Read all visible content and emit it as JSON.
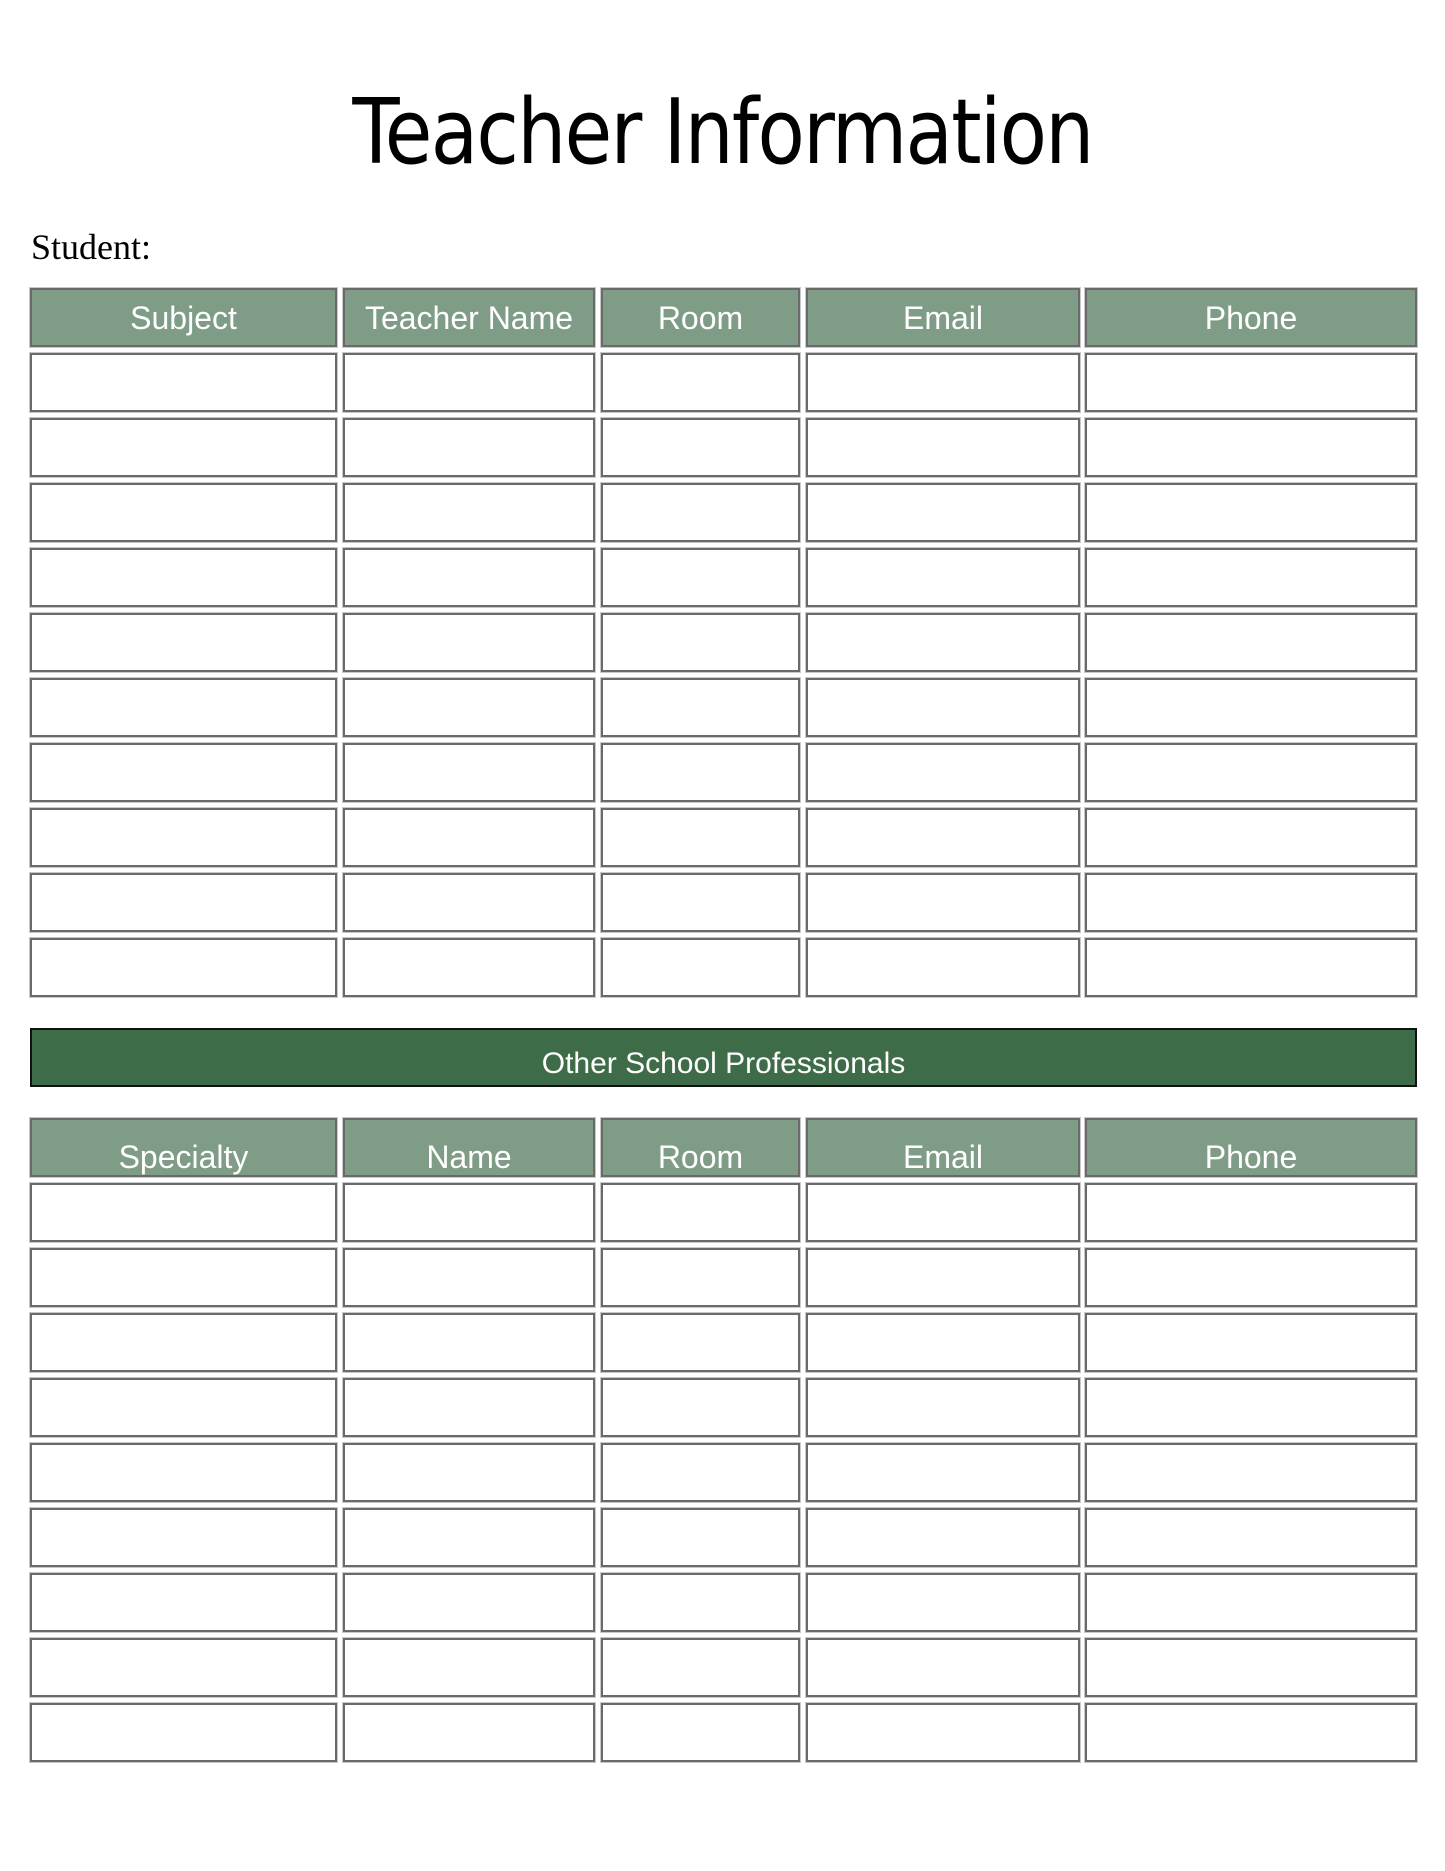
{
  "page": {
    "title": "Teacher Information",
    "student_label": "Student:"
  },
  "teachers_table": {
    "headers": [
      "Subject",
      "Teacher Name",
      "Room",
      "Email",
      "Phone"
    ],
    "rows": [
      [
        "",
        "",
        "",
        "",
        ""
      ],
      [
        "",
        "",
        "",
        "",
        ""
      ],
      [
        "",
        "",
        "",
        "",
        ""
      ],
      [
        "",
        "",
        "",
        "",
        ""
      ],
      [
        "",
        "",
        "",
        "",
        ""
      ],
      [
        "",
        "",
        "",
        "",
        ""
      ],
      [
        "",
        "",
        "",
        "",
        ""
      ],
      [
        "",
        "",
        "",
        "",
        ""
      ],
      [
        "",
        "",
        "",
        "",
        ""
      ],
      [
        "",
        "",
        "",
        "",
        ""
      ]
    ]
  },
  "section_banner": {
    "label": "Other School Professionals"
  },
  "professionals_table": {
    "headers": [
      "Specialty",
      "Name",
      "Room",
      "Email",
      "Phone"
    ],
    "rows": [
      [
        "",
        "",
        "",
        "",
        ""
      ],
      [
        "",
        "",
        "",
        "",
        ""
      ],
      [
        "",
        "",
        "",
        "",
        ""
      ],
      [
        "",
        "",
        "",
        "",
        ""
      ],
      [
        "",
        "",
        "",
        "",
        ""
      ],
      [
        "",
        "",
        "",
        "",
        ""
      ],
      [
        "",
        "",
        "",
        "",
        ""
      ],
      [
        "",
        "",
        "",
        "",
        ""
      ],
      [
        "",
        "",
        "",
        "",
        ""
      ]
    ]
  },
  "colors": {
    "header_fill": "#7f9c86",
    "banner_fill": "#3e6b48",
    "cell_border": "#6a6a6a"
  }
}
